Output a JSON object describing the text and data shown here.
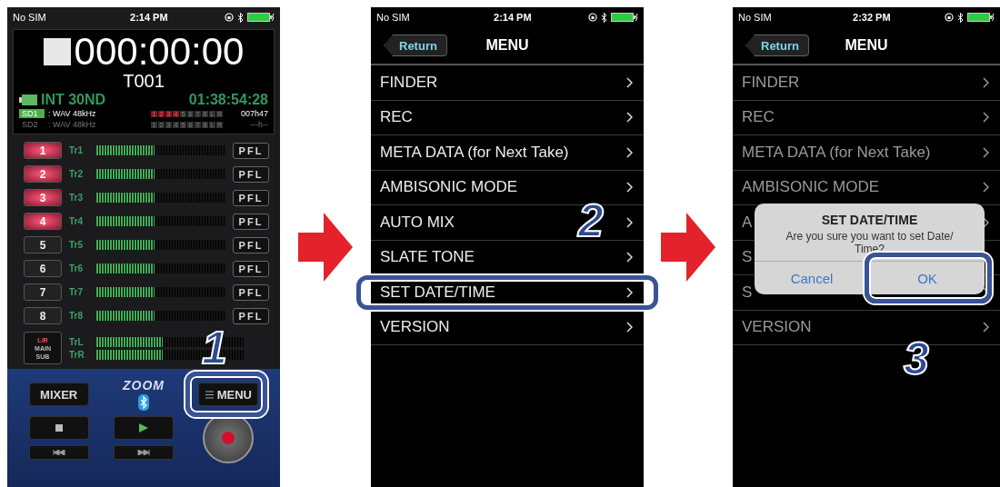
{
  "panels": [
    {
      "kind": "recorder",
      "step": "1",
      "status": {
        "carrier": "No SIM",
        "time": "2:14 PM"
      },
      "display": {
        "counter": "000:00:00",
        "take": "T001",
        "battery": "INT 30ND",
        "remaining": "01:38:54:28",
        "cards": [
          {
            "name": "SD1",
            "format": ": WAV 48kHz",
            "time": "007h47",
            "active": true,
            "channels": [
              {
                "label": "1",
                "on": true
              },
              {
                "label": "2",
                "on": true
              },
              {
                "label": "3",
                "on": true
              },
              {
                "label": "4",
                "on": true
              },
              {
                "label": "5",
                "on": false
              },
              {
                "label": "6",
                "on": false
              },
              {
                "label": "7",
                "on": false
              },
              {
                "label": "8",
                "on": false
              },
              {
                "label": "L",
                "on": false
              },
              {
                "label": "R",
                "on": false
              }
            ]
          },
          {
            "name": "SD2",
            "format": ": WAV 48kHz",
            "time": "---h--",
            "active": false,
            "channels": [
              {
                "label": "1",
                "on": false
              },
              {
                "label": "2",
                "on": false
              },
              {
                "label": "3",
                "on": false
              },
              {
                "label": "4",
                "on": false
              },
              {
                "label": "5",
                "on": false
              },
              {
                "label": "6",
                "on": false
              },
              {
                "label": "7",
                "on": false
              },
              {
                "label": "8",
                "on": false
              },
              {
                "label": "L",
                "on": false
              },
              {
                "label": "R",
                "on": false
              }
            ]
          }
        ]
      },
      "tracks": [
        {
          "number": "1",
          "armed": true,
          "label": "Tr1",
          "level": 0.45,
          "pfl": "PFL"
        },
        {
          "number": "2",
          "armed": true,
          "label": "Tr2",
          "level": 0.45,
          "pfl": "PFL"
        },
        {
          "number": "3",
          "armed": true,
          "label": "Tr3",
          "level": 0.45,
          "pfl": "PFL"
        },
        {
          "number": "4",
          "armed": true,
          "label": "Tr4",
          "level": 0.45,
          "pfl": "PFL"
        },
        {
          "number": "5",
          "armed": false,
          "label": "Tr5",
          "level": 0.45,
          "pfl": "PFL"
        },
        {
          "number": "6",
          "armed": false,
          "label": "Tr6",
          "level": 0.45,
          "pfl": "PFL"
        },
        {
          "number": "7",
          "armed": false,
          "label": "Tr7",
          "level": 0.45,
          "pfl": "PFL"
        },
        {
          "number": "8",
          "armed": false,
          "label": "Tr8",
          "level": 0.45,
          "pfl": "PFL"
        }
      ],
      "mix": {
        "lines": [
          "L/R",
          "MAIN",
          "SUB"
        ],
        "meters": [
          {
            "label": "TrL",
            "level": 0.45
          },
          {
            "label": "TrR",
            "level": 0.45
          }
        ]
      },
      "controls": {
        "mixer": "MIXER",
        "logo": "ZOOM",
        "menu": "MENU",
        "menu_highlighted": true
      }
    },
    {
      "kind": "menu",
      "step": "2",
      "status": {
        "carrier": "No SIM",
        "time": "2:14 PM"
      },
      "back": "Return",
      "title": "MENU",
      "rows": [
        {
          "label": "FINDER",
          "highlighted": false
        },
        {
          "label": "REC",
          "highlighted": false
        },
        {
          "label": "META DATA (for Next Take)",
          "highlighted": false
        },
        {
          "label": "AMBISONIC MODE",
          "highlighted": false
        },
        {
          "label": "AUTO MIX",
          "highlighted": false
        },
        {
          "label": "SLATE TONE",
          "highlighted": false
        },
        {
          "label": "SET DATE/TIME",
          "highlighted": true
        },
        {
          "label": "VERSION",
          "highlighted": false
        }
      ]
    },
    {
      "kind": "menu",
      "step": "3",
      "status": {
        "carrier": "No SIM",
        "time": "2:32 PM"
      },
      "back": "Return",
      "title": "MENU",
      "rows": [
        {
          "label": "FINDER",
          "highlighted": false
        },
        {
          "label": "REC",
          "highlighted": false
        },
        {
          "label": "META DATA (for Next Take)",
          "highlighted": false
        },
        {
          "label": "AMBISONIC MODE",
          "highlighted": false
        },
        {
          "label": "A",
          "highlighted": false
        },
        {
          "label": "S",
          "highlighted": false
        },
        {
          "label": "S",
          "highlighted": false
        },
        {
          "label": "VERSION",
          "highlighted": false
        }
      ],
      "dialog": {
        "title": "SET DATE/TIME",
        "message": "Are you sure you want to set Date/ Time?",
        "buttons": [
          {
            "label": "Cancel",
            "highlighted": false
          },
          {
            "label": "OK",
            "highlighted": true
          }
        ]
      }
    }
  ]
}
